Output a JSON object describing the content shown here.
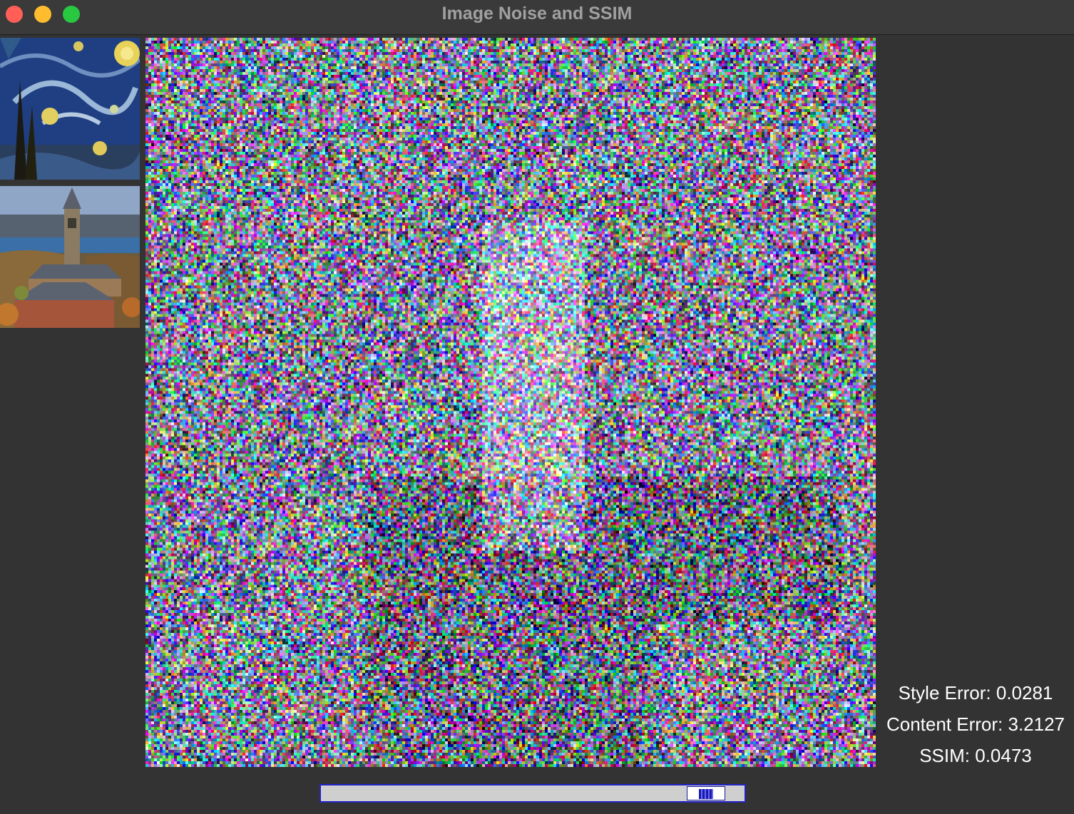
{
  "window": {
    "title": "Image Noise and SSIM"
  },
  "thumbnails": [
    {
      "name": "starry-night-style-image"
    },
    {
      "name": "clock-tower-content-image"
    }
  ],
  "stats": {
    "style_error": "Style Error: 0.0281",
    "content_error": "Content Error: 3.2127",
    "ssim": "SSIM: 0.0473"
  },
  "noise_slider": {
    "value_fraction": 0.95
  },
  "colors": {
    "background": "#333333",
    "titlebar": "#3a3a3a",
    "slider_border": "#2323c8",
    "slider_track": "#cfcfcf"
  }
}
